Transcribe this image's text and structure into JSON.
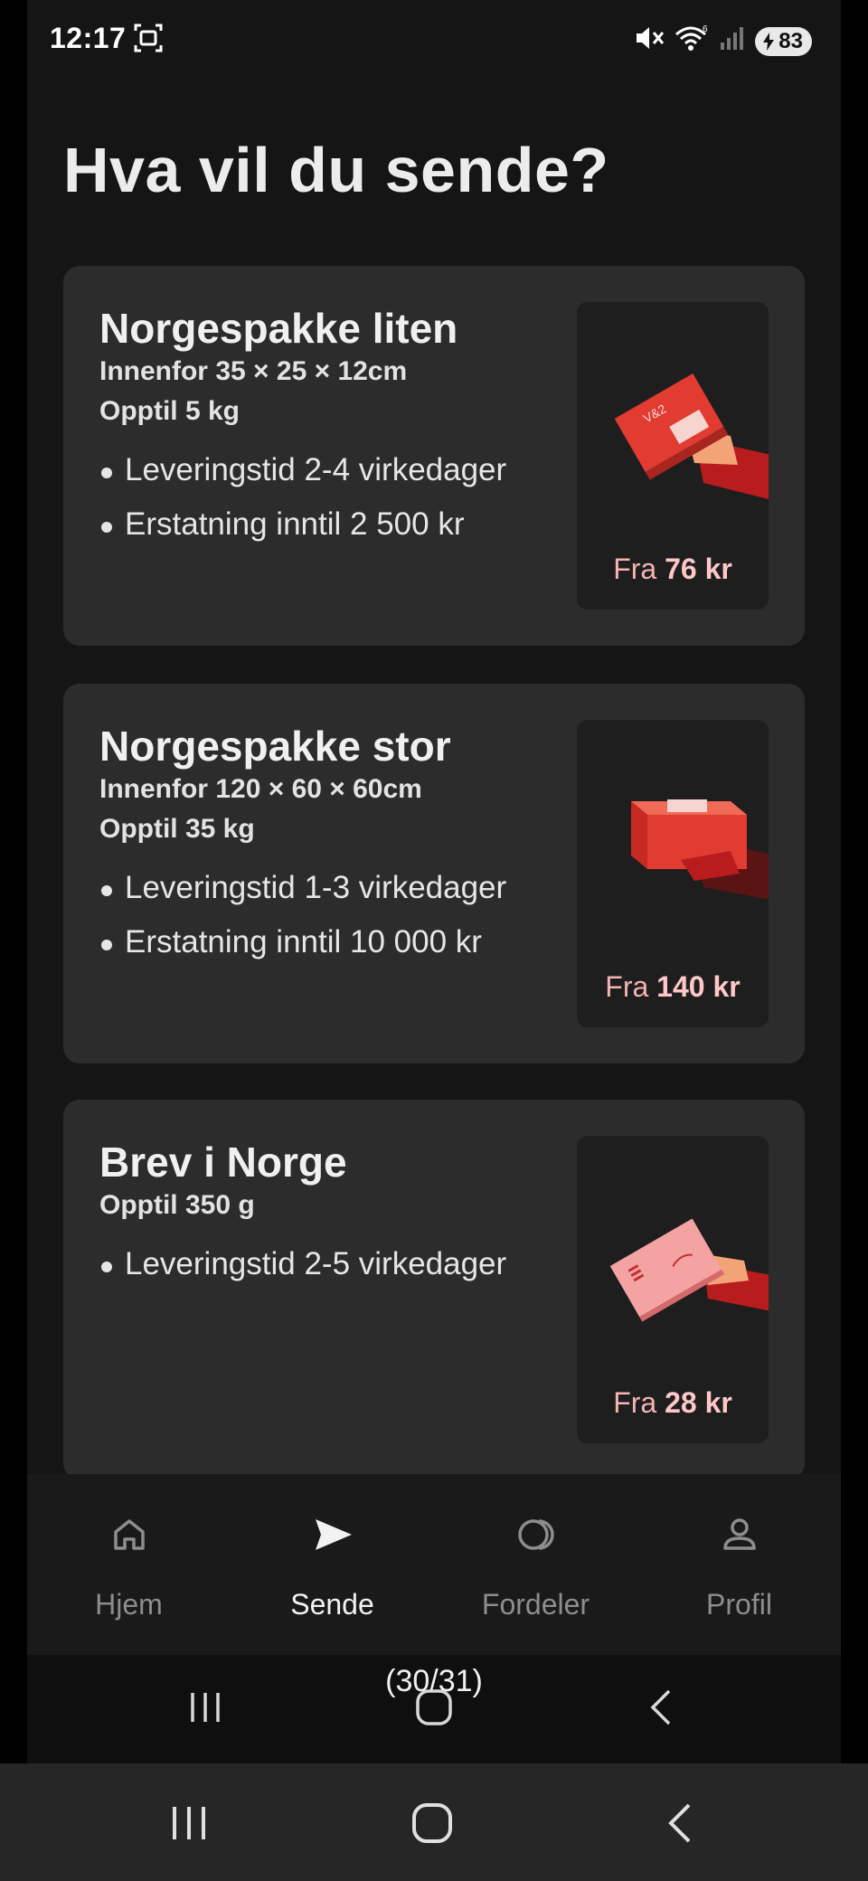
{
  "status_bar": {
    "time": "12:17",
    "battery": "83"
  },
  "page": {
    "title": "Hva vil du sende?"
  },
  "products": [
    {
      "title": "Norgespakke liten",
      "specs": [
        "Innenfor 35 × 25 × 12cm",
        "Opptil 5 kg"
      ],
      "features": [
        "Leveringstid 2-4 virkedager",
        "Erstatning inntil 2 500 kr"
      ],
      "price_prefix": "Fra",
      "price_value": "76 kr",
      "illustration": "small-package-in-hand"
    },
    {
      "title": "Norgespakke stor",
      "specs": [
        "Innenfor 120 × 60 × 60cm",
        "Opptil 35 kg"
      ],
      "features": [
        "Leveringstid 1-3 virkedager",
        "Erstatning inntil 10 000 kr"
      ],
      "price_prefix": "Fra",
      "price_value": "140 kr",
      "illustration": "large-package-in-hand"
    },
    {
      "title": "Brev i Norge",
      "specs": [
        "Opptil 350 g"
      ],
      "features": [
        "Leveringstid 2-5 virkedager"
      ],
      "price_prefix": "Fra",
      "price_value": "28 kr",
      "illustration": "letter-in-hand"
    }
  ],
  "nav": {
    "items": [
      {
        "label": "Hjem",
        "icon": "home-icon"
      },
      {
        "label": "Sende",
        "icon": "send-icon",
        "active": true
      },
      {
        "label": "Fordeler",
        "icon": "benefits-icon"
      },
      {
        "label": "Profil",
        "icon": "profile-icon"
      }
    ]
  },
  "screenshot_counter": "(30/31)",
  "colors": {
    "background": "#151515",
    "card": "#2c2c2c",
    "price": "#f5b3b3",
    "package_red": "#e23b32"
  }
}
